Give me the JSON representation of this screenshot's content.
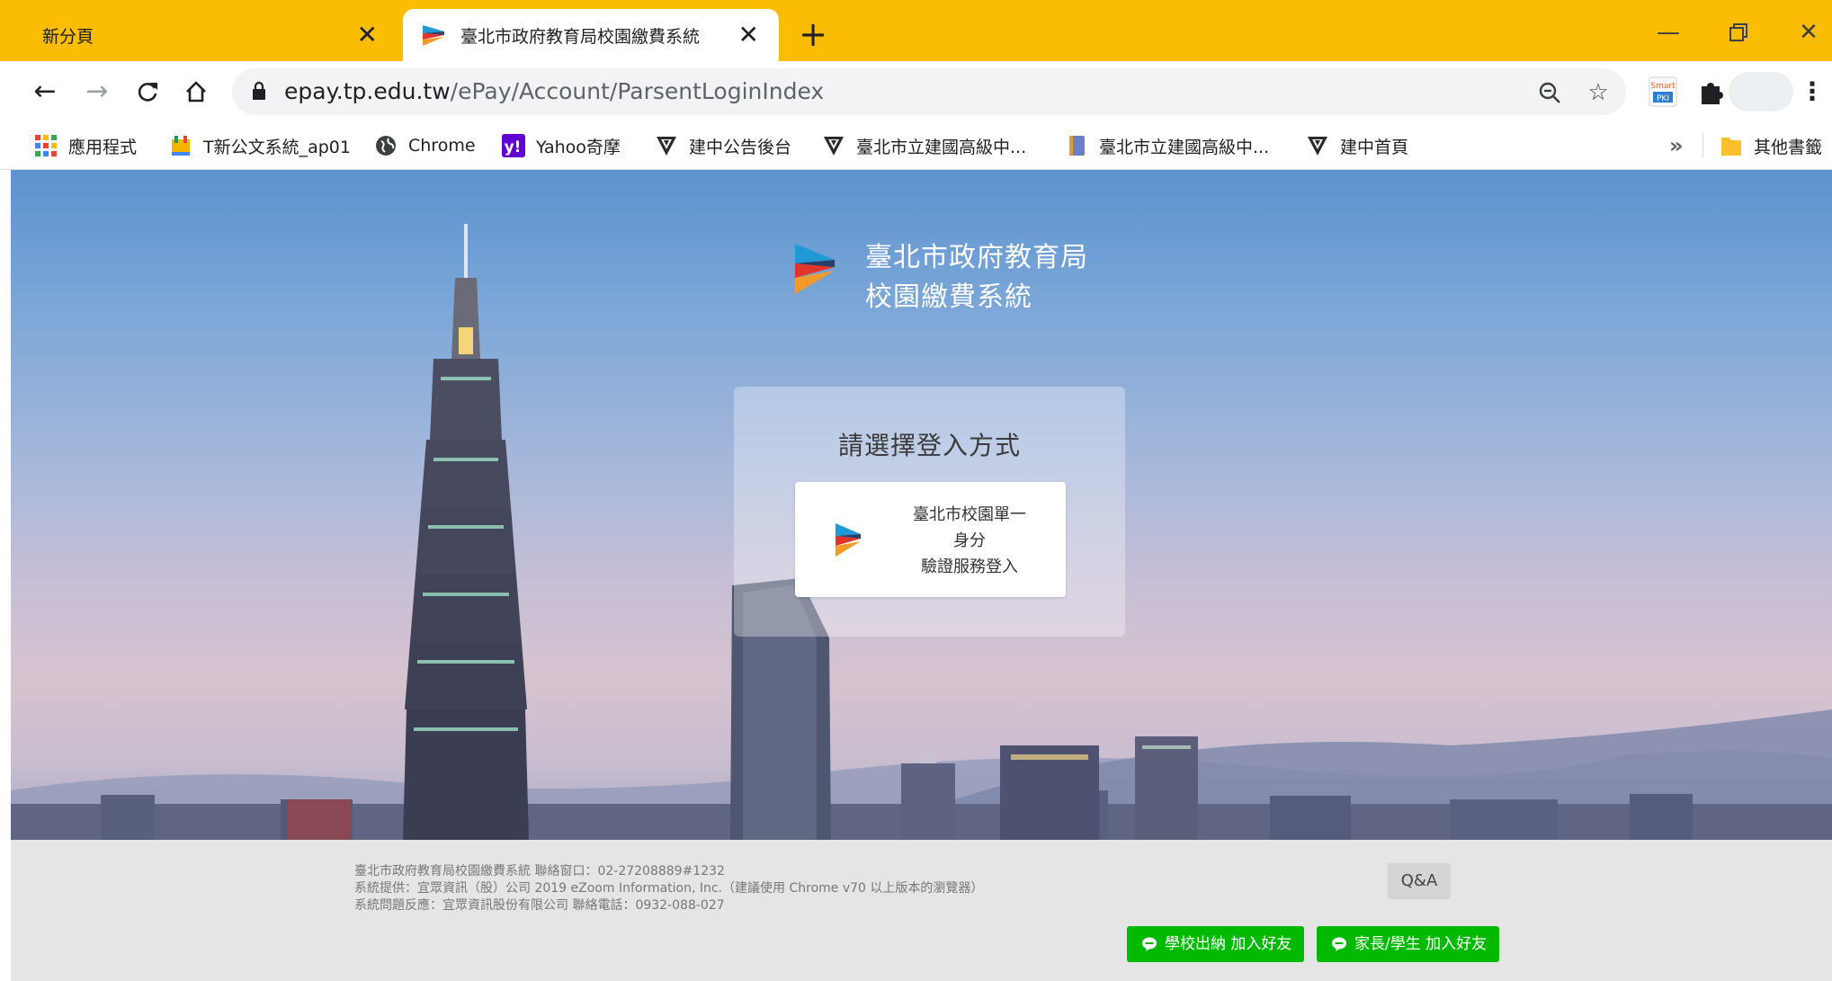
{
  "browser": {
    "tabs": [
      {
        "title": "新分頁",
        "active": false
      },
      {
        "title": "臺北市政府教育局校園繳費系統",
        "active": true
      }
    ],
    "new_tab": "+",
    "url_host": "epay.tp.edu.tw",
    "url_path": "/ePay/Account/ParsentLoginIndex",
    "bookmarks": [
      {
        "label": "應用程式",
        "icon": "apps-grid-icon"
      },
      {
        "label": "T新公文系統_ap01",
        "icon": "document-system-icon"
      },
      {
        "label": "Chrome",
        "icon": "globe-icon"
      },
      {
        "label": "Yahoo奇摩",
        "icon": "yahoo-icon"
      },
      {
        "label": "建中公告後台",
        "icon": "school-shield-icon"
      },
      {
        "label": "臺北市立建國高級中...",
        "icon": "school-shield-icon"
      },
      {
        "label": "臺北市立建國高級中...",
        "icon": "notebook-icon"
      },
      {
        "label": "建中首頁",
        "icon": "school-shield-icon"
      }
    ],
    "bookmarks_more": "»",
    "other_bookmarks": "其他書籤",
    "extension_label": "Smart PKI",
    "colors": {
      "tabstrip": "#fbbc04"
    }
  },
  "page": {
    "brand_line1": "臺北市政府教育局",
    "brand_line2": "校園繳費系統",
    "login_heading": "請選擇登入方式",
    "sso_line1": "臺北市校園單一",
    "sso_line2": "身分",
    "sso_line3": "驗證服務登入"
  },
  "footer": {
    "info_line1": "臺北市政府教育局校園繳費系統 聯絡窗口：02-27208889#1232",
    "info_line2": "系統提供：宜眾資訊（股）公司 2019 eZoom Information, Inc.（建議使用 Chrome v70 以上版本的瀏覽器）",
    "info_line3": "系統問題反應：宜眾資訊股份有限公司 聯絡電話：0932-088-027",
    "qa_label": "Q&A",
    "line_school": "學校出納 加入好友",
    "line_parent": "家長/學生 加入好友",
    "colors": {
      "line_green": "#00b900"
    }
  }
}
